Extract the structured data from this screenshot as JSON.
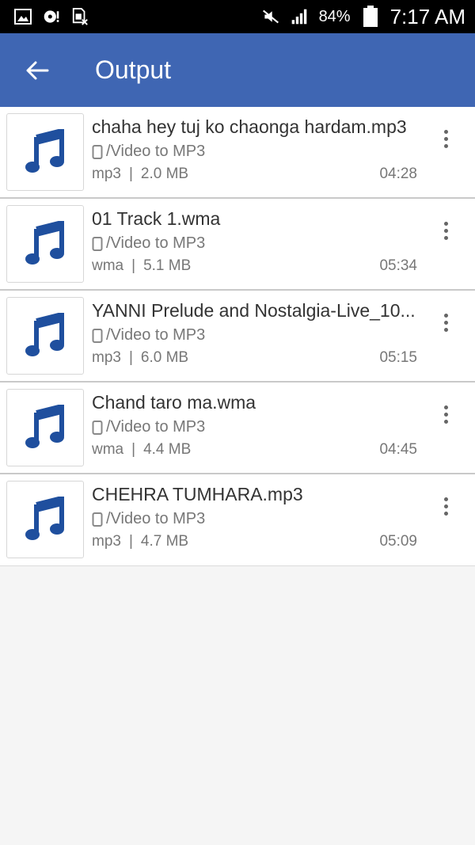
{
  "status_bar": {
    "battery": "84%",
    "time": "7:17 AM",
    "icons_left": [
      "gallery-icon",
      "disc-icon",
      "sim-error-icon"
    ],
    "icons_right": [
      "mute-icon",
      "signal-icon",
      "battery-icon"
    ]
  },
  "app_bar": {
    "title": "Output",
    "back_icon": "back-arrow-icon",
    "color": "#3f66b3"
  },
  "files": [
    {
      "title": "chaha hey tuj ko chaonga hardam.mp3",
      "path": "/Video to MP3",
      "format": "mp3",
      "size": "2.0 MB",
      "duration": "04:28"
    },
    {
      "title": "01 Track 1.wma",
      "path": "/Video to MP3",
      "format": "wma",
      "size": "5.1 MB",
      "duration": "05:34"
    },
    {
      "title": "YANNI Prelude and Nostalgia-Live_10...",
      "path": "/Video to MP3",
      "format": "mp3",
      "size": "6.0 MB",
      "duration": "05:15"
    },
    {
      "title": "Chand taro ma.wma",
      "path": "/Video to MP3",
      "format": "wma",
      "size": "4.4 MB",
      "duration": "04:45"
    },
    {
      "title": "CHEHRA TUMHARA.mp3",
      "path": "/Video to MP3",
      "format": "mp3",
      "size": "4.7 MB",
      "duration": "05:09"
    }
  ],
  "separator": "|",
  "accent_note_color": "#1f4f9e"
}
